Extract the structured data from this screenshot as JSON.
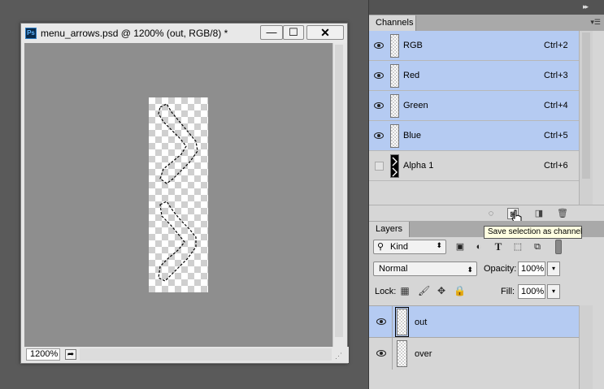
{
  "document": {
    "title": "menu_arrows.psd @ 1200% (out, RGB/8) *",
    "app_logo": "Ps",
    "zoom": "1200%",
    "buttons": {
      "minimize": "—",
      "maximize": "☐",
      "close": "✕"
    }
  },
  "channels_panel": {
    "tab_label": "Channels",
    "channels": [
      {
        "name": "RGB",
        "shortcut": "Ctrl+2",
        "selected": true,
        "visible": true
      },
      {
        "name": "Red",
        "shortcut": "Ctrl+3",
        "selected": true,
        "visible": true
      },
      {
        "name": "Green",
        "shortcut": "Ctrl+4",
        "selected": true,
        "visible": true
      },
      {
        "name": "Blue",
        "shortcut": "Ctrl+5",
        "selected": true,
        "visible": true
      },
      {
        "name": "Alpha 1",
        "shortcut": "Ctrl+6",
        "selected": false,
        "visible": false
      }
    ],
    "tooltip": "Save selection as channel"
  },
  "layers_panel": {
    "tab_label": "Layers",
    "filter_kind": "Kind",
    "blend_mode": "Normal",
    "opacity_label": "Opacity:",
    "opacity_value": "100%",
    "lock_label": "Lock:",
    "fill_label": "Fill:",
    "fill_value": "100%",
    "layers": [
      {
        "name": "out",
        "selected": true,
        "visible": true
      },
      {
        "name": "over",
        "selected": false,
        "visible": true
      }
    ]
  },
  "colors": {
    "selection_blue": "#b5cbf2",
    "panel_gray": "#d6d6d6",
    "canvas_gray": "#8e8e8e",
    "tooltip_bg": "#ffffe1"
  }
}
